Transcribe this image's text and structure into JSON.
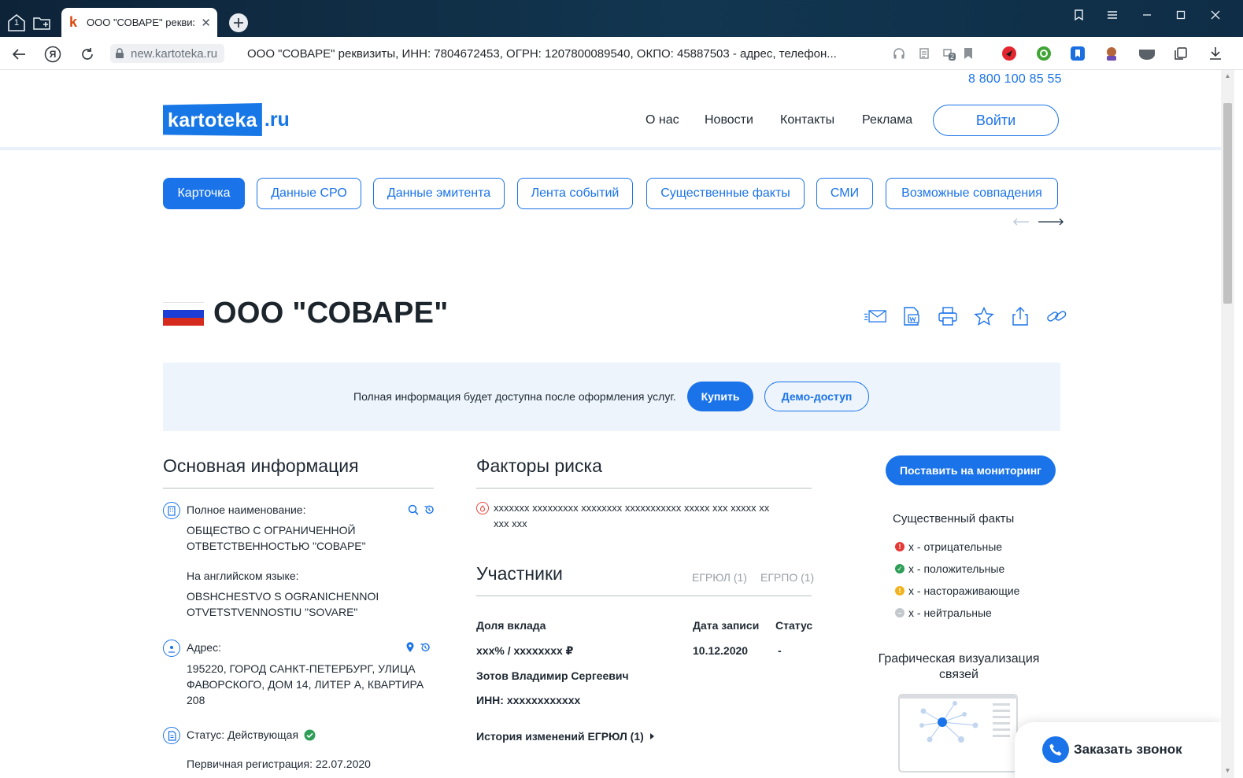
{
  "browser": {
    "tab_title": "ООО \"СОВАРЕ\" реквизиты",
    "tab_favicon_letter": "k",
    "tab_count": "1",
    "domain": "new.kartoteka.ru",
    "page_title": "ООО \"СОВАРЕ\" реквизиты, ИНН: 7804672453, ОГРН: 1207800089540, ОКПО: 45887503 - адрес, телефон...",
    "badge_count": "2",
    "yandex_letter": "Я"
  },
  "site": {
    "phone": "8 800 100 85 55",
    "logo_main": "kartoteka",
    "logo_suffix": ".ru",
    "nav": [
      {
        "label": "О нас"
      },
      {
        "label": "Новости"
      },
      {
        "label": "Контакты"
      },
      {
        "label": "Реклама"
      }
    ],
    "login_label": "Войти"
  },
  "tabs": [
    {
      "label": "Карточка",
      "active": true
    },
    {
      "label": "Данные СРО"
    },
    {
      "label": "Данные эмитента"
    },
    {
      "label": "Лента событий"
    },
    {
      "label": "Существенные факты"
    },
    {
      "label": "СМИ"
    },
    {
      "label": "Возможные совпадения"
    }
  ],
  "company": {
    "name": "ООО \"СОВАРЕ\""
  },
  "banner": {
    "text": "Полная информация будет доступна после оформления услуг.",
    "buy_label": "Купить",
    "demo_label": "Демо-доступ"
  },
  "main_info": {
    "title": "Основная информация",
    "full_name_label": "Полное наименование:",
    "full_name_line1": "ОБЩЕСТВО С ОГРАНИЧЕННОЙ",
    "full_name_line2": "ОТВЕТСТВЕННОСТЬЮ \"СОВАРЕ\"",
    "english_label": "На английском языке:",
    "english_line1": "OBSHCHESTVO S OGRANICHENNOI",
    "english_line2": "OTVETSTVENNOSTIU \"SOVARE\"",
    "address_label": "Адрес:",
    "address_line1": "195220, ГОРОД САНКТ-ПЕТЕРБУРГ, УЛИЦА",
    "address_line2": "ФАВОРСКОГО, ДОМ 14, ЛИТЕР А, КВАРТИРА",
    "address_line3": "208",
    "status_label": "Статус: Действующая",
    "registration_label": "Первичная регистрация: 22.07.2020"
  },
  "risk": {
    "title": "Факторы риска",
    "line1": "xxxxxxx xxxxxxxxx xxxxxxxx xxxxxxxxxxx xxxxx xxx xxxxx xx",
    "line2": "xxx xxx"
  },
  "participants": {
    "title": "Участники",
    "tab_egrul": "ЕГРЮЛ (1)",
    "tab_egrpo": "ЕГРПО (1)",
    "col_share": "Доля вклада",
    "col_date": "Дата записи",
    "col_status": "Статус",
    "share_value": "xxx% / xxxxxxxx ₽",
    "date_value": "10.12.2020",
    "status_value": "-",
    "person_name": "Зотов Владимир Сергеевич",
    "inn": "ИНН: xxxxxxxxxxxx",
    "history_link": "История изменений ЕГРЮЛ (1)"
  },
  "sidebar": {
    "monitor_label": "Поставить на мониторинг",
    "facts_title": "Существенный факты",
    "facts": [
      {
        "label": "x - отрицательные",
        "color": "#e53935",
        "symbol": "!"
      },
      {
        "label": "x - положительные",
        "color": "#2e9e57",
        "symbol": "✓"
      },
      {
        "label": "x - настораживающие",
        "color": "#f2b21c",
        "symbol": "!"
      },
      {
        "label": "x - нейтральные",
        "color": "#b0b6bc",
        "symbol": "–"
      }
    ],
    "graph_title_line1": "Графическая визуализация",
    "graph_title_line2": "связей"
  },
  "callback": {
    "label": "Заказать звонок"
  },
  "colors": {
    "accent": "#1a73e8",
    "banner_bg": "#edf4fb",
    "status_ok": "#2e9e57"
  }
}
